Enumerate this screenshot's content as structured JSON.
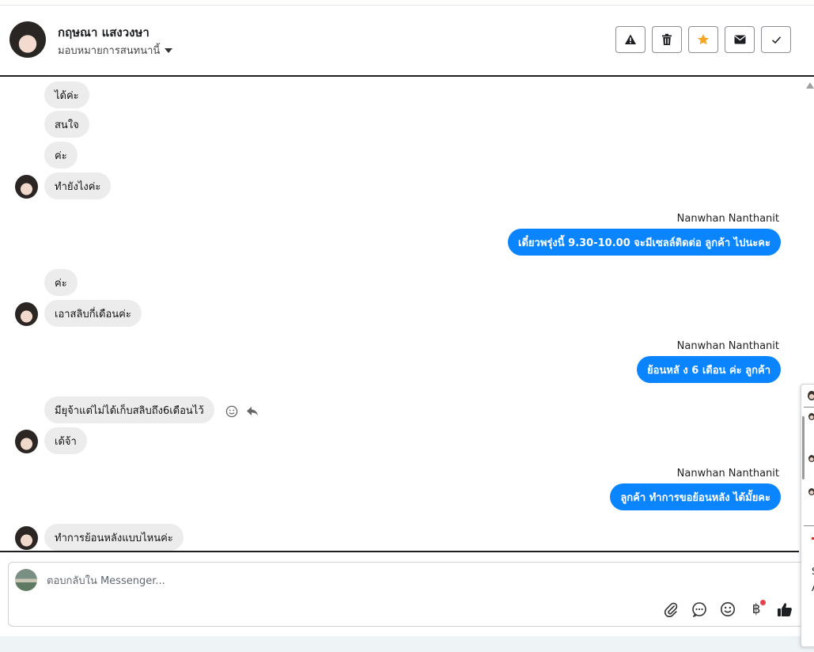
{
  "header": {
    "contact_name": "กฤษณา แสงวงษา",
    "assign_label": "มอบหมายการสนทนานี้",
    "actions": [
      {
        "name": "report-button",
        "icon": "warning-icon"
      },
      {
        "name": "delete-button",
        "icon": "trash-icon"
      },
      {
        "name": "star-button",
        "icon": "star-icon",
        "color": "#f5a623"
      },
      {
        "name": "mail-button",
        "icon": "envelope-icon"
      },
      {
        "name": "done-button",
        "icon": "check-icon"
      }
    ]
  },
  "thread": {
    "incoming": [
      {
        "text": "ได้ค่ะ"
      },
      {
        "text": "สนใจ"
      },
      {
        "text": "ค่ะ"
      },
      {
        "text": "ทำยังไงค่ะ"
      },
      {
        "text": "ค่ะ"
      },
      {
        "text": "เอาสลิบกี่เดือนค่ะ"
      },
      {
        "text": "มียุจ้าแต่ไม่ได้เก็บสลิบถึง6เดือนไว้"
      },
      {
        "text": "เด้จ้า"
      },
      {
        "text": "ทำการย้อนหลังแบบไหนค่ะ"
      }
    ],
    "outgoing": [
      {
        "sender": "Nanwhan Nanthanit",
        "text": "เดี๋ยวพรุ่งนี้  9.30-10.00 จะมีเซลล์ติดต่อ ลูกค้า ไปนะคะ"
      },
      {
        "sender": "Nanwhan Nanthanit",
        "text": "ย้อนหลั ง 6 เดือน ค่ะ  ลูกค้า"
      },
      {
        "sender": "Nanwhan Nanthanit",
        "text": "ลูกค้า ทำการขอย้อนหลัง ได้มั้ยคะ"
      }
    ]
  },
  "composer": {
    "placeholder": "ตอบกลับใน Messenger...",
    "value": "",
    "tools": [
      "paperclip-icon",
      "chat-bubble-icon",
      "smiley-icon",
      "baht-icon",
      "thumbs-up-icon"
    ],
    "baht_symbol": "฿"
  },
  "side_panel": {
    "chars": [
      "S",
      "A"
    ]
  },
  "colors": {
    "accent": "#0a84ff",
    "incoming_bubble": "#ececec",
    "notification_dot": "#e8414d"
  }
}
